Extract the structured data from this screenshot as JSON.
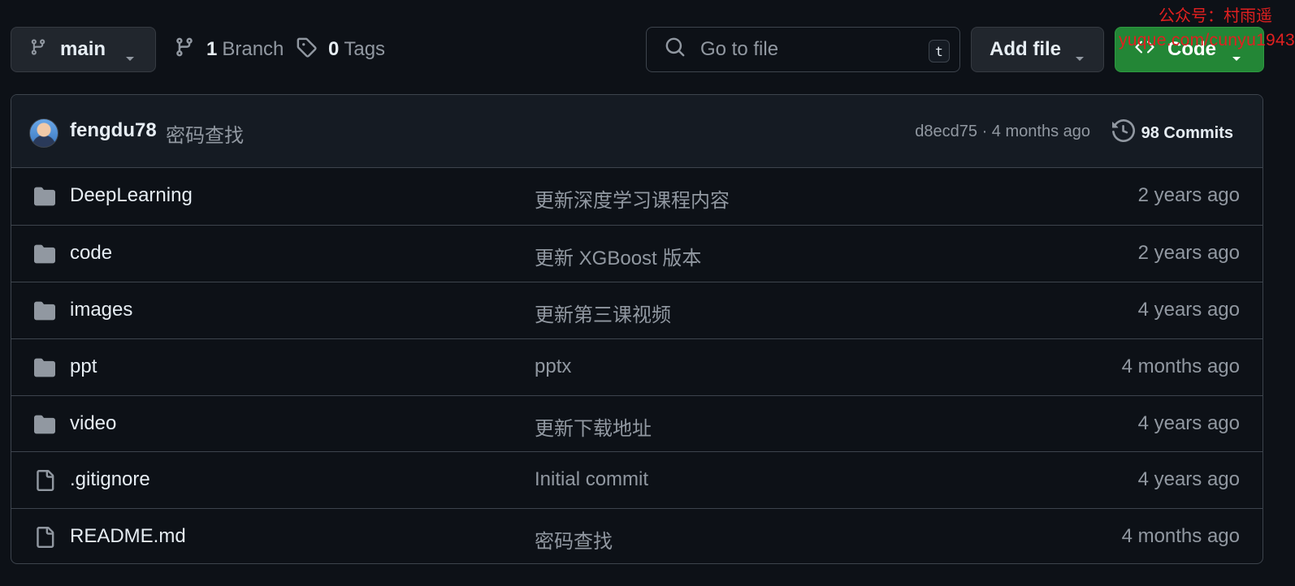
{
  "toolbar": {
    "branch_label": "main",
    "branch_count": "1",
    "branch_word": "Branch",
    "tag_count": "0",
    "tag_word": "Tags",
    "search_placeholder": "Go to file",
    "search_shortcut": "t",
    "add_file_label": "Add file",
    "code_label": "Code"
  },
  "watermark": {
    "line1": "公众号：村雨遥",
    "line2": "yuque.com/cunyu1943"
  },
  "latest_commit": {
    "author": "fengdu78",
    "message": "密码查找",
    "hash": "d8ecd75",
    "separator": "·",
    "age": "4 months ago",
    "commits_label": "98 Commits"
  },
  "files": [
    {
      "type": "folder-icon",
      "name": "DeepLearning",
      "message": "更新深度学习课程内容",
      "date": "2 years ago"
    },
    {
      "type": "folder-icon",
      "name": "code",
      "message": "更新 XGBoost 版本",
      "date": "2 years ago"
    },
    {
      "type": "folder-icon",
      "name": "images",
      "message": "更新第三课视频",
      "date": "4 years ago"
    },
    {
      "type": "folder-icon",
      "name": "ppt",
      "message": "pptx",
      "date": "4 months ago"
    },
    {
      "type": "folder-icon",
      "name": "video",
      "message": "更新下载地址",
      "date": "4 years ago"
    },
    {
      "type": "file-icon",
      "name": ".gitignore",
      "message": "Initial commit",
      "date": "4 years ago"
    },
    {
      "type": "file-icon",
      "name": "README.md",
      "message": "密码查找",
      "date": "4 months ago"
    }
  ],
  "colors": {
    "background": "#0d1117",
    "header_bg": "#151b23",
    "border": "#3d444d",
    "text": "#e6edf3",
    "muted": "#9198a1",
    "code_button": "#238636",
    "watermark": "#e02020"
  }
}
